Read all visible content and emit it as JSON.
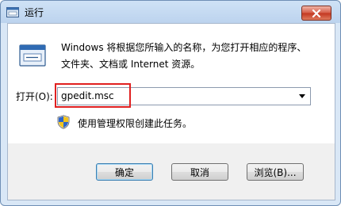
{
  "window": {
    "title": "运行"
  },
  "content": {
    "description": "Windows 将根据您所输入的名称，为您打开相应的程序、\n文件夹、文档或 Internet 资源。",
    "open_label": "打开(O):",
    "command_value": "gpedit.msc",
    "admin_note": "使用管理权限创建此任务。"
  },
  "buttons": {
    "ok": "确定",
    "cancel": "取消",
    "browse": "浏览(B)..."
  },
  "icons": {
    "app": "run-icon",
    "close": "close-icon",
    "dropdown": "chevron-down-icon",
    "shield": "uac-shield-icon"
  },
  "colors": {
    "highlight": "#e02020",
    "close_button": "#c2361f"
  }
}
